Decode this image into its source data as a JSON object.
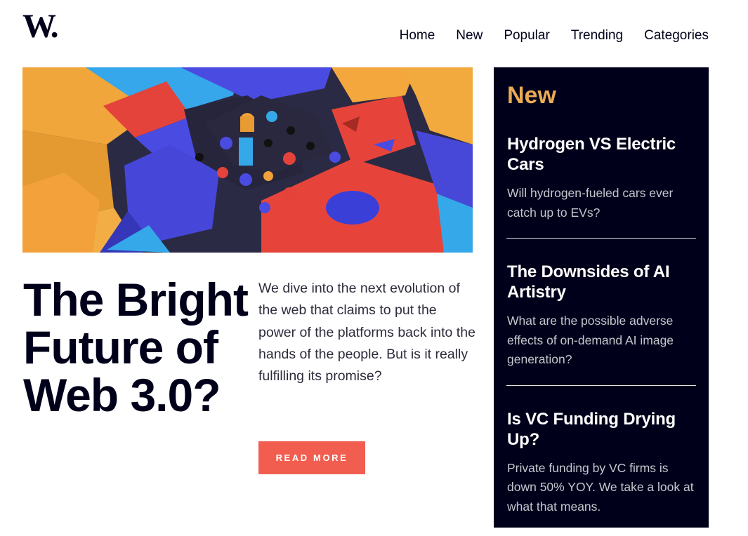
{
  "header": {
    "logo": "W.",
    "nav": [
      "Home",
      "New",
      "Popular",
      "Trending",
      "Categories"
    ]
  },
  "hero": {
    "image_alt": "abstract colorful 3D blocks",
    "headline": "The Bright Future of Web 3.0?",
    "description": "We dive into the next evolution of the web that claims to put the power of the platforms back into the hands of the people. But is it really fulfilling its promise?",
    "button_label": "READ MORE"
  },
  "sidebar": {
    "title": "New",
    "items": [
      {
        "title": "Hydrogen VS Electric Cars",
        "summary": "Will hydrogen-fueled cars ever catch up to EVs?"
      },
      {
        "title": "The Downsides of AI Artistry",
        "summary": "What are the possible adverse effects of on-demand AI image generation?"
      },
      {
        "title": "Is VC Funding Drying Up?",
        "summary": "Private funding by VC firms is down 50% YOY. We take a look at what that means."
      }
    ]
  },
  "colors": {
    "dark_navy": "#00001a",
    "accent_orange": "#e9ab53",
    "button_red": "#f15e50"
  }
}
